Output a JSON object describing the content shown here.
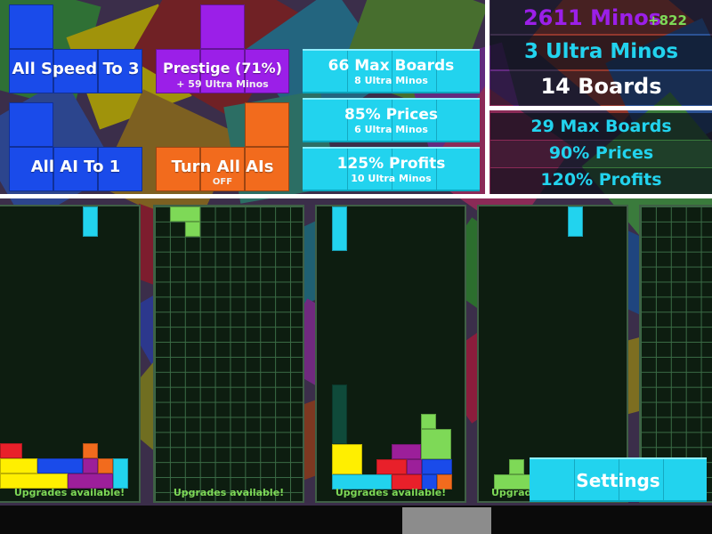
{
  "colors": {
    "blue": "#1a4bea",
    "purple": "#9b1fe8",
    "orange": "#f26b1d",
    "cyan": "#22d3ee",
    "green": "#7ed957",
    "red": "#e8202a",
    "yellow": "#ffef00",
    "magenta": "#9c1f9a",
    "teal_dark": "#0f4a3a",
    "board_bg": "#0d1d10",
    "frame": "#ffffff"
  },
  "buttons": {
    "all_speed": {
      "label": "All Speed To 3"
    },
    "prestige": {
      "label": "Prestige (71%)",
      "sub": "+ 59 Ultra Minos"
    },
    "all_ai": {
      "label": "All AI To 1"
    },
    "turn_all_ais": {
      "label": "Turn All AIs",
      "sub": "OFF"
    },
    "max_boards": {
      "label": "66 Max Boards",
      "sub": "8 Ultra Minos"
    },
    "prices": {
      "label": "85% Prices",
      "sub": "6 Ultra Minos"
    },
    "profits": {
      "label": "125% Profits",
      "sub": "10 Ultra Minos"
    },
    "settings": {
      "label": "Settings"
    }
  },
  "stats": {
    "minos": "2611 Minos",
    "minos_gain": "+822",
    "ultra_minos": "3 Ultra Minos",
    "boards": "14 Boards",
    "max_boards": "29 Max Boards",
    "prices": "90% Prices",
    "profits": "120% Profits"
  },
  "icons": {
    "settings_button": "settings-button"
  },
  "boards": [
    {
      "upgrades": "Upgrades available!",
      "grid": false
    },
    {
      "upgrades": "Upgrades available!",
      "grid": true
    },
    {
      "upgrades": "Upgrades available!",
      "grid": false
    },
    {
      "upgrades": "Upgrades available!",
      "grid": false
    },
    {
      "upgrades": "",
      "grid": true
    }
  ]
}
